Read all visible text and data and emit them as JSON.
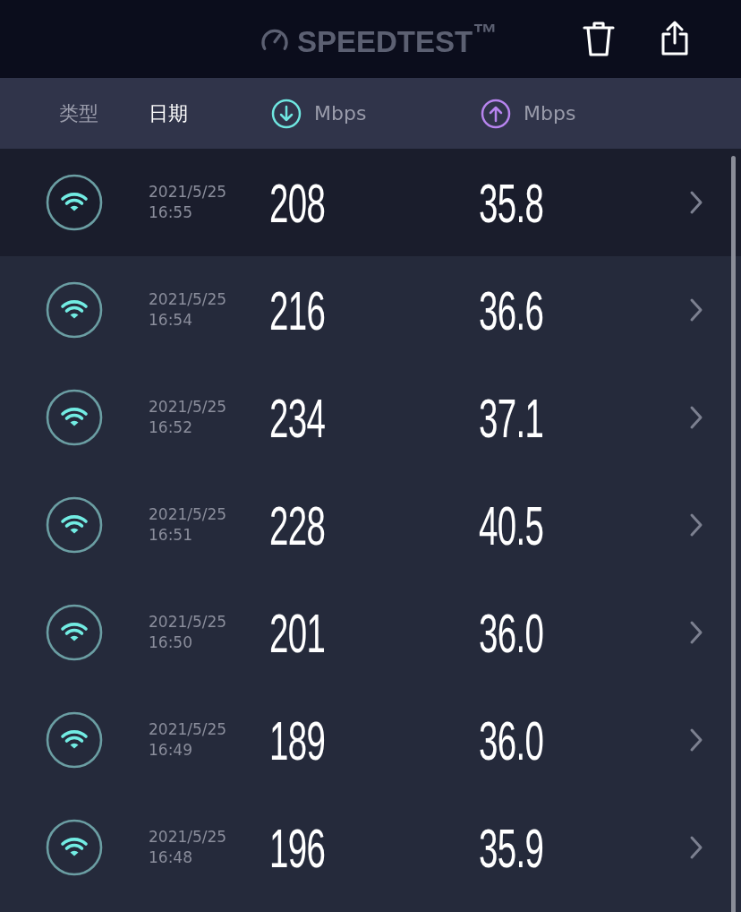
{
  "app_bar": {
    "logo": "SPEEDTEST$^{™}$"
  },
  "columns": [
    {
      "label": "类型",
      "kind": "text",
      "selected": false
    },
    {
      "label": "日期",
      "kind": "text",
      "selected": true
    },
    {
      "label": "Mbps",
      "kind": "download",
      "selected": false
    },
    {
      "label": "Mbps",
      "kind": "upload",
      "selected": false
    }
  ],
  "results": [
    {
      "date": "2021/5/25",
      "time": "16:55",
      "download": "208",
      "upload": "35.8",
      "selected": true
    },
    {
      "date": "2021/5/25",
      "time": "16:54",
      "download": "216",
      "upload": "36.6",
      "selected": false
    },
    {
      "date": "2021/5/25",
      "time": "16:52",
      "download": "234",
      "upload": "37.1",
      "selected": false
    },
    {
      "date": "2021/5/25",
      "time": "16:51",
      "download": "228",
      "upload": "40.5",
      "selected": false
    },
    {
      "date": "2021/5/25",
      "time": "16:50",
      "download": "201",
      "upload": "36.0",
      "selected": false
    },
    {
      "date": "2021/5/25",
      "time": "16:49",
      "download": "189",
      "upload": "36.0",
      "selected": false
    },
    {
      "date": "2021/5/25",
      "time": "16:48",
      "download": "196",
      "upload": "35.9",
      "selected": false
    }
  ]
}
